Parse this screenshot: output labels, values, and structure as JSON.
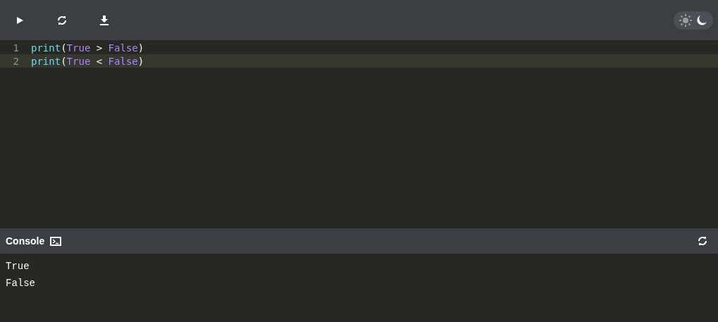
{
  "toolbar": {
    "theme_options": [
      {
        "kind": "light",
        "selected": false
      },
      {
        "kind": "dark",
        "selected": true
      }
    ]
  },
  "editor": {
    "lines": [
      {
        "number": "1",
        "active": false,
        "tokens": [
          {
            "text": "print",
            "kind": "builtin"
          },
          {
            "text": "(",
            "kind": "punct"
          },
          {
            "text": "True",
            "kind": "constant"
          },
          {
            "text": " > ",
            "kind": "punct"
          },
          {
            "text": "False",
            "kind": "constant"
          },
          {
            "text": ")",
            "kind": "punct"
          }
        ]
      },
      {
        "number": "2",
        "active": true,
        "tokens": [
          {
            "text": "print",
            "kind": "builtin"
          },
          {
            "text": "(",
            "kind": "punct"
          },
          {
            "text": "True",
            "kind": "constant"
          },
          {
            "text": " < ",
            "kind": "punct"
          },
          {
            "text": "False",
            "kind": "constant"
          },
          {
            "text": ")",
            "kind": "punct"
          }
        ]
      }
    ]
  },
  "console": {
    "title": "Console",
    "output": [
      "True",
      "False"
    ]
  }
}
